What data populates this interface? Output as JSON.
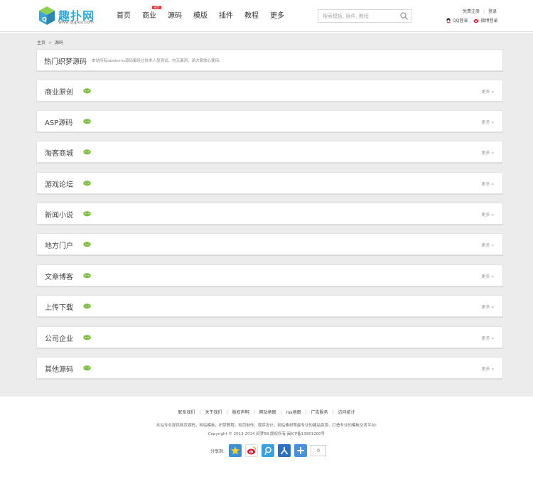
{
  "header": {
    "logo_text": "趣扑网",
    "logo_url": "www.qupuu.com",
    "nav": [
      {
        "label": "首页"
      },
      {
        "label": "商业",
        "badge": "HOT"
      },
      {
        "label": "源码"
      },
      {
        "label": "模版"
      },
      {
        "label": "插件"
      },
      {
        "label": "教程"
      },
      {
        "label": "更多"
      }
    ],
    "search_placeholder": "搜索模板, 插件, 教程",
    "register": "免费注册",
    "login": "登录",
    "qq_login": "QQ登录",
    "weibo_login": "微博登录"
  },
  "breadcrumb": {
    "home": "主页",
    "current": "源码"
  },
  "intro": {
    "title": "热门织梦源码",
    "desc": "本站所有dedecms源码都经过技术人员测试，均无漏洞，请大家放心使用。"
  },
  "categories": [
    {
      "title": "商业原创",
      "more": "更多"
    },
    {
      "title": "ASP源码",
      "more": "更多"
    },
    {
      "title": "淘客商城",
      "more": "更多"
    },
    {
      "title": "游戏论坛",
      "more": "更多"
    },
    {
      "title": "新闻小说",
      "more": "更多"
    },
    {
      "title": "地方门户",
      "more": "更多"
    },
    {
      "title": "文章博客",
      "more": "更多"
    },
    {
      "title": "上传下载",
      "more": "更多"
    },
    {
      "title": "公司企业",
      "more": "更多"
    },
    {
      "title": "其他源码",
      "more": "更多"
    }
  ],
  "footer": {
    "links": [
      "联系我们",
      "关于我们",
      "版权声明",
      "网站地图",
      "rss地图",
      "广告服务",
      "访问统计"
    ],
    "line1": "本站专业提供网页源码，网站模板，织梦教程，网页制作，程序设计，网站素材等最专业的建站资源，打造专业的模板交流平台!",
    "line2": "Copyright © 2013-2014 织梦58 版权所有 闽ICP备13951200号",
    "share_label": "分享到:",
    "share_count": "0"
  },
  "colors": {
    "accent": "#32a8d8",
    "bubble": "#7bbf3c",
    "hot": "#e4393c",
    "main_bg": "#ececec"
  }
}
